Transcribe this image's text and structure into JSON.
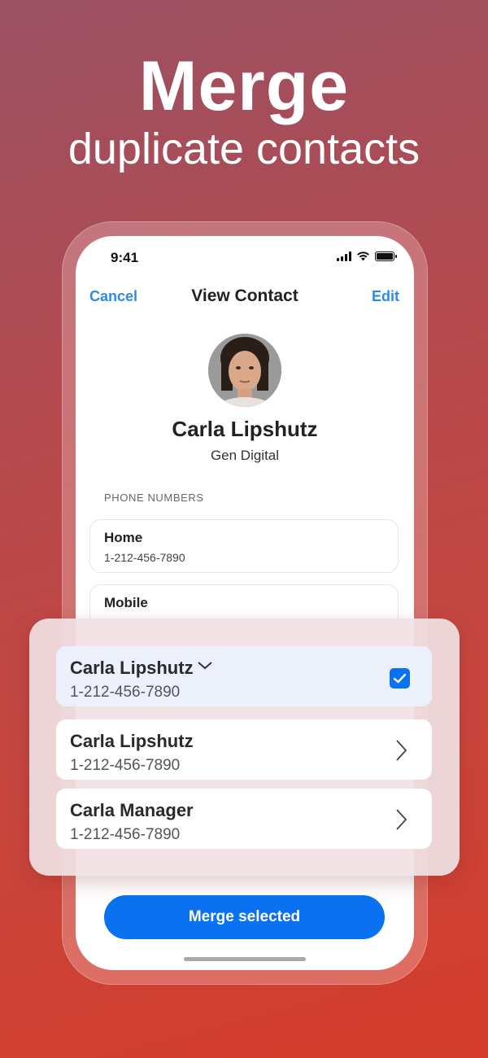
{
  "headline": {
    "line1": "Merge",
    "line2": "duplicate contacts"
  },
  "status_bar": {
    "time": "9:41",
    "icons": [
      "signal-icon",
      "wifi-icon",
      "battery-icon"
    ]
  },
  "nav": {
    "cancel_label": "Cancel",
    "title": "View Contact",
    "edit_label": "Edit"
  },
  "contact": {
    "name": "Carla Lipshutz",
    "company": "Gen Digital"
  },
  "phone_section": {
    "label": "PHONE NUMBERS",
    "items": [
      {
        "label": "Home",
        "number": "1-212-456-7890"
      },
      {
        "label": "Mobile",
        "number": ""
      }
    ]
  },
  "duplicates": [
    {
      "name": "Carla Lipshutz",
      "number": "1-212-456-7890",
      "selected": true,
      "icon": "chevron-down-icon"
    },
    {
      "name": "Carla Lipshutz",
      "number": "1-212-456-7890",
      "selected": false,
      "icon": "chevron-right-icon"
    },
    {
      "name": "Carla Manager",
      "number": "1-212-456-7890",
      "selected": false,
      "icon": "chevron-right-icon"
    }
  ],
  "merge_button_label": "Merge selected",
  "colors": {
    "accent": "#0a72f0",
    "link": "#2b8ce6",
    "background_top": "#9a5163",
    "background_bottom": "#d43c2b"
  }
}
